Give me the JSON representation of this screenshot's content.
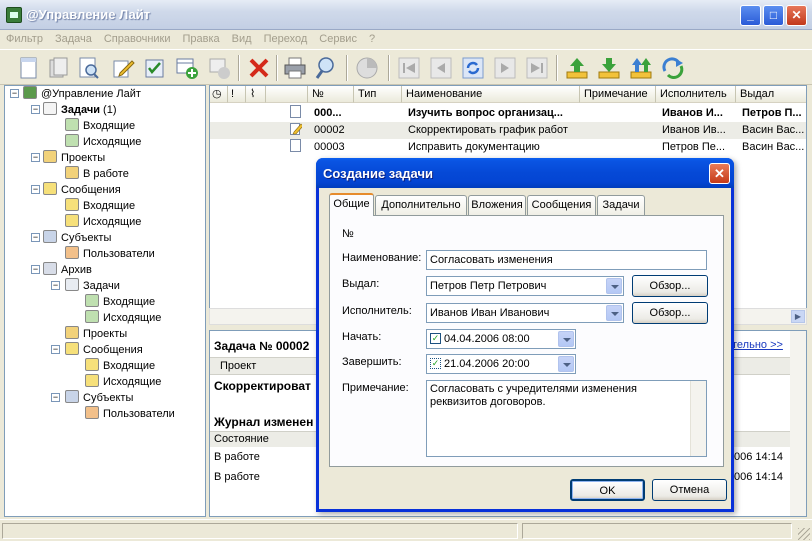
{
  "window": {
    "title": "@Управление Лайт"
  },
  "menu": [
    "Фильтр",
    "Задача",
    "Справочники",
    "Правка",
    "Вид",
    "Переход",
    "Сервис",
    "?"
  ],
  "tree": {
    "root": "@Управление Лайт",
    "tasks": "Задачи",
    "tasks_count": "(1)",
    "tasks_in": "Входящие",
    "tasks_out": "Исходящие",
    "projects": "Проекты",
    "projects_work": "В работе",
    "messages": "Сообщения",
    "messages_in": "Входящие",
    "messages_out": "Исходящие",
    "subjects": "Субъекты",
    "users": "Пользователи",
    "archive": "Архив",
    "arch_tasks": "Задачи",
    "arch_tasks_in": "Входящие",
    "arch_tasks_out": "Исходящие",
    "arch_projects": "Проекты",
    "arch_messages": "Сообщения",
    "arch_messages_in": "Входящие",
    "arch_messages_out": "Исходящие",
    "arch_subjects": "Субъекты",
    "arch_users": "Пользователи"
  },
  "grid": {
    "columns": [
      "№",
      "Тип",
      "Наименование",
      "Примечание",
      "Исполнитель",
      "Выдал"
    ],
    "rows": [
      {
        "num": "000...",
        "name": "Изучить вопрос организац...",
        "note": "",
        "exec": "Иванов И...",
        "by": "Петров П...",
        "bold": true
      },
      {
        "num": "00002",
        "name": "Скорректировать график работ",
        "note": "",
        "exec": "Иванов Ив...",
        "by": "Васин Вас..."
      },
      {
        "num": "00003",
        "name": "Исправить документацию",
        "note": "",
        "exec": "Петров Пе...",
        "by": "Васин Вас..."
      }
    ]
  },
  "detail": {
    "heading": "Задача № 00002",
    "more_link": "тельно >>",
    "project_label": "Проект",
    "task_name": "Скорректироват",
    "journal": "Журнал изменен",
    "state_col": "Состояние",
    "state1": "В работе",
    "state2": "В работе",
    "date1": "006 14:14",
    "date2": "006 14:14"
  },
  "dialog": {
    "title": "Создание задачи",
    "tabs": [
      "Общие",
      "Дополнительно",
      "Вложения",
      "Сообщения",
      "Задачи"
    ],
    "num_label": "№",
    "name_label": "Наименование:",
    "name_value": "Согласовать изменения",
    "issued_label": "Выдал:",
    "issued_value": "Петров Петр Петрович",
    "exec_label": "Исполнитель:",
    "exec_value": "Иванов Иван Иванович",
    "browse": "Обзор...",
    "start_label": "Начать:",
    "start_value": "04.04.2006  08:00",
    "end_label": "Завершить:",
    "end_value": "21.04.2006  20:00",
    "note_label": "Примечание:",
    "note_value_1": "Согласовать с учредителями изменения",
    "note_value_2": "реквизитов договоров.",
    "ok": "OK",
    "cancel": "Отмена"
  },
  "colors": {
    "dialog_border": "#0831d9",
    "tree_border": "#7f9db9",
    "tab_active": "#e68b2c"
  }
}
